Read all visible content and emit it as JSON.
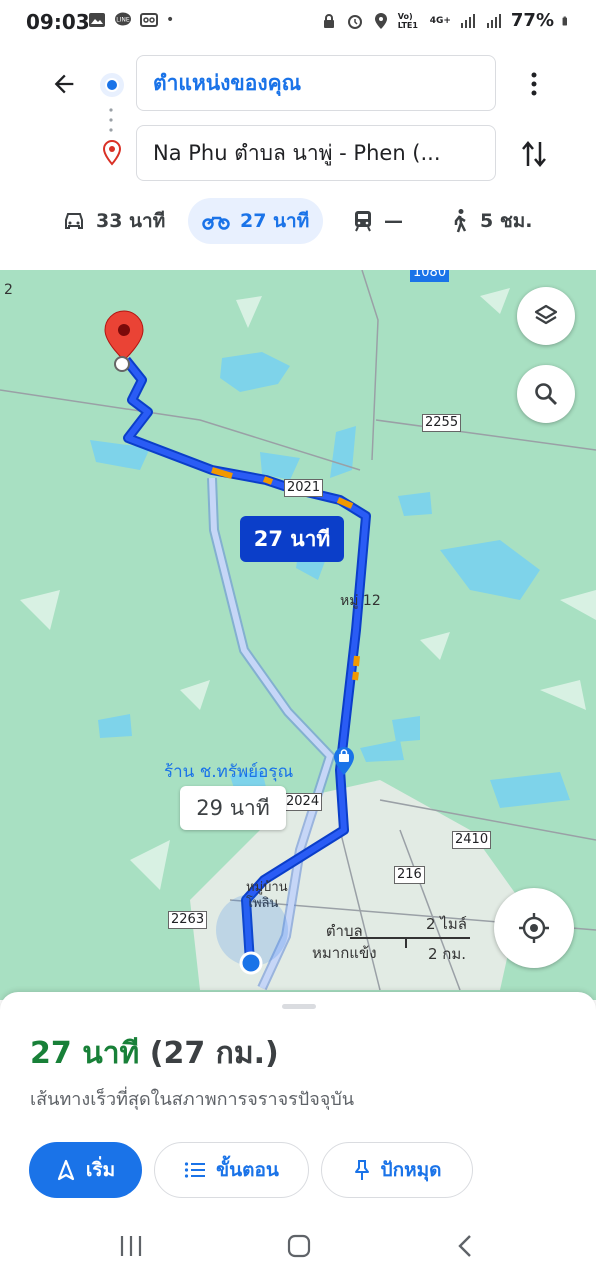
{
  "status_bar": {
    "time": "09:03",
    "battery": "77%",
    "network": "4G+",
    "volte": "Vo) LTE1"
  },
  "header": {
    "origin_value": "ตำแหน่งของคุณ",
    "destination_value": "Na Phu ตำบล นาพู่ - Phen (...",
    "modes": [
      {
        "name": "car",
        "label": "33 นาที"
      },
      {
        "name": "motorcycle",
        "label": "27 นาที"
      },
      {
        "name": "transit",
        "label": "—"
      },
      {
        "name": "walk",
        "label": "5 ชม."
      }
    ]
  },
  "map": {
    "route_main_label": "27 นาที",
    "route_alt_label": "29 นาที",
    "roads": [
      "2255",
      "2021",
      "2024",
      "2410",
      "216",
      "2263",
      "1080",
      "2"
    ],
    "village_label": "หมู่ 12",
    "place_shop": "ร้าน ช.ทรัพย์อรุณ",
    "village_ban": "หมู่บ้าน\nโพลิน",
    "subdistrict": "ตำบล\nหมากแข้ง",
    "scale_miles": "2 ไมล์",
    "scale_km": "2 กม."
  },
  "sheet": {
    "duration": "27 นาที",
    "distance": "(27 กม.)",
    "description": "เส้นทางเร็วที่สุดในสภาพการจราจรปัจจุบัน",
    "start_label": "เริ่ม",
    "steps_label": "ขั้นตอน",
    "pin_label": "ปักหมุด"
  },
  "colors": {
    "accent": "#1a73e8",
    "route": "#1a3fd6",
    "map_green": "#a8e0c2",
    "water": "#7ed3ea",
    "duration_green": "#188038"
  }
}
